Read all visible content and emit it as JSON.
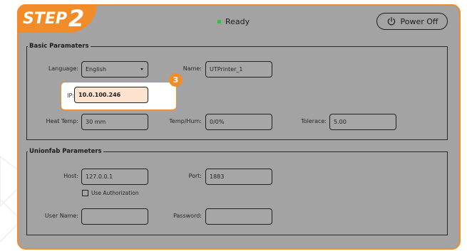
{
  "step": {
    "word": "STEP",
    "number": "2"
  },
  "marker": "3",
  "status": {
    "text": "Ready"
  },
  "power_button": {
    "label": "Power Off"
  },
  "basic": {
    "legend": "Basic Paramaters",
    "language": {
      "label": "Language:",
      "value": "English"
    },
    "name": {
      "label": "Name:",
      "value": "UTPrinter_1"
    },
    "ip": {
      "label": "IP:",
      "value": "10.0.100.246"
    },
    "heat_temp": {
      "label": "Heat Temp:",
      "value": "30 mm"
    },
    "temp_hum": {
      "label": "Temp/Hum:",
      "value": "0/0%"
    },
    "tolerace": {
      "label": "Tolerace:",
      "value": "5.00"
    }
  },
  "unionfab": {
    "legend": "Unionfab Parameters",
    "host": {
      "label": "Host:",
      "value": "127.0.0.1"
    },
    "port": {
      "label": "Port:",
      "value": "1883"
    },
    "use_auth": {
      "label": "Use Authorization",
      "checked": false
    },
    "user_name": {
      "label": "User Name:",
      "value": ""
    },
    "password": {
      "label": "Password:",
      "value": ""
    }
  },
  "colors": {
    "accent": "#f28c28",
    "panel": "#a3a3a3",
    "status_dot": "#2fc23a",
    "ip_field": "#fde2cf"
  }
}
